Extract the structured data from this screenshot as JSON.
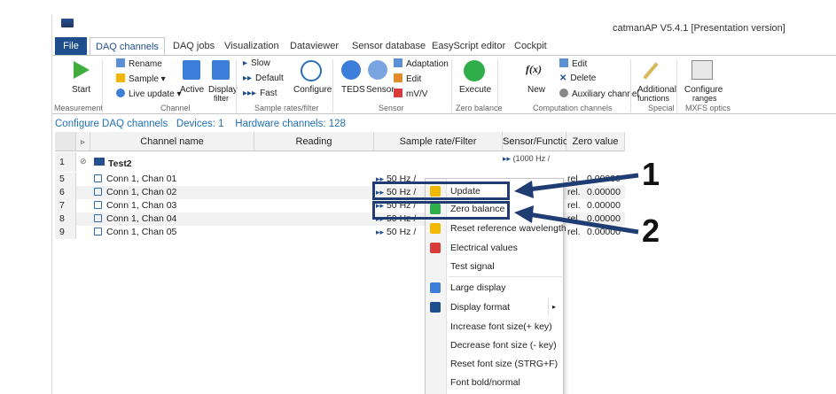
{
  "app": {
    "title": "catmanAP V5.4.1 [Presentation version]"
  },
  "tabs": [
    {
      "label": "File"
    },
    {
      "label": "DAQ channels"
    },
    {
      "label": "DAQ jobs"
    },
    {
      "label": "Visualization"
    },
    {
      "label": "Dataviewer"
    },
    {
      "label": "Sensor database"
    },
    {
      "label": "EasyScript editor"
    },
    {
      "label": "Cockpit"
    }
  ],
  "ribbon": {
    "start": "Start",
    "rename": "Rename",
    "sample": "Sample",
    "live_update": "Live update",
    "active": "Active",
    "display_filter_1": "Display",
    "display_filter_2": "filter",
    "slow": "Slow",
    "default": "Default",
    "fast": "Fast",
    "configure": "Configure",
    "teds": "TEDS",
    "sensor": "Sensor",
    "adaptation": "Adaptation",
    "edit_sensor": "Edit",
    "mv_v": "mV/V",
    "execute": "Execute",
    "new": "New",
    "edit_comp": "Edit",
    "delete": "Delete",
    "aux_channel": "Auxiliary channel",
    "additional_1": "Additional",
    "additional_2": "functions",
    "configure_ranges_1": "Configure",
    "configure_ranges_2": "ranges",
    "groups": {
      "measurement": "Measurement",
      "channel": "Channel",
      "sample_rates": "Sample rates/filter",
      "sensor": "Sensor",
      "zero_balance": "Zero balance",
      "computation": "Computation channels",
      "special": "Special",
      "mxfs": "MXFS optics"
    }
  },
  "subbar": {
    "configure": "Configure DAQ channels",
    "devices": "Devices: 1",
    "hardware": "Hardware channels: 128"
  },
  "table": {
    "headers": {
      "channel_name": "Channel name",
      "reading": "Reading",
      "sample_rate": "Sample rate/Filter",
      "sensor_function": "Sensor/Function",
      "zero_value": "Zero value"
    },
    "device_row": {
      "num": "1",
      "name": "Test2",
      "reading": "",
      "rate": "",
      "sensor": "(1000 Hz /",
      "zero": ""
    },
    "rows": [
      {
        "num": "5",
        "name": "Conn 1, Chan 01",
        "rate": "50 Hz /",
        "sensor": "rel.",
        "zero": "0.00000"
      },
      {
        "num": "6",
        "name": "Conn 1, Chan 02",
        "rate": "50 Hz /",
        "sensor": "rel.",
        "zero": "0.00000"
      },
      {
        "num": "7",
        "name": "Conn 1, Chan 03",
        "rate": "50 Hz /",
        "sensor": "rel.",
        "zero": "0.00000"
      },
      {
        "num": "8",
        "name": "Conn 1, Chan 04",
        "rate": "50 Hz /",
        "sensor": "rel.",
        "zero": "0.00000"
      },
      {
        "num": "9",
        "name": "Conn 1, Chan 05",
        "rate": "50 Hz /",
        "sensor": "rel.",
        "zero": "0.00000"
      }
    ]
  },
  "context_menu": [
    {
      "label": "Update",
      "icon": "lightning-icon"
    },
    {
      "label": "Zero balance",
      "icon": "zero-balance-icon"
    },
    {
      "label": "Reset reference wavelength",
      "icon": "wavelength-icon"
    },
    {
      "label": "Electrical values",
      "icon": "electrical-icon"
    },
    {
      "label": "Test signal",
      "icon": ""
    },
    {
      "label": "Large display",
      "icon": "large-display-icon"
    },
    {
      "label": "Display format",
      "icon": "display-format-icon"
    },
    {
      "label": "Increase font size(+ key)",
      "icon": ""
    },
    {
      "label": "Decrease font size (- key)",
      "icon": ""
    },
    {
      "label": "Reset font size (STRG+F)",
      "icon": ""
    },
    {
      "label": "Font bold/normal",
      "icon": ""
    }
  ],
  "annotations": {
    "label_1": "1",
    "label_2": "2",
    "arrow_color": "#1f3d73"
  }
}
